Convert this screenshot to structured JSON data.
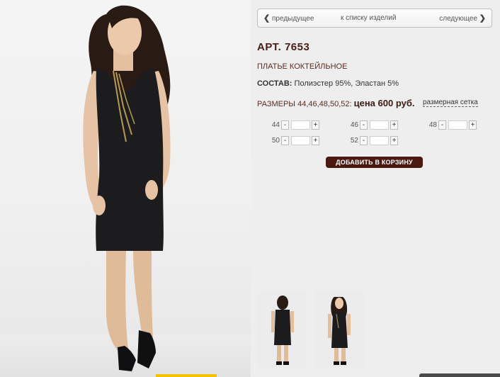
{
  "nav": {
    "prev": "предыдущее",
    "list": "к списку изделий",
    "next": "следующее"
  },
  "product": {
    "article": "АРТ. 7653",
    "title": "ПЛАТЬЕ КОКТЕЙЛЬНОЕ",
    "composition_label": "СОСТАВ:",
    "composition": "Полиэстер 95%, Эластан 5%",
    "sizes_label": "РАЗМЕРЫ 44,46,48,50,52:",
    "price": "цена 600 руб.",
    "size_chart": "размерная сетка"
  },
  "sizes": [
    {
      "label": "44",
      "minus": "-",
      "plus": "+",
      "qty": ""
    },
    {
      "label": "46",
      "minus": "-",
      "plus": "+",
      "qty": ""
    },
    {
      "label": "48",
      "minus": "-",
      "plus": "+",
      "qty": ""
    },
    {
      "label": "50",
      "minus": "-",
      "plus": "+",
      "qty": ""
    },
    {
      "label": "52",
      "minus": "-",
      "plus": "+",
      "qty": ""
    }
  ],
  "add_to_cart": "ДОБАВИТЬ В КОРЗИНУ",
  "icons": {
    "prev": "chevron-left-icon",
    "next": "chevron-right-icon"
  },
  "colors": {
    "brand": "#4a1a10",
    "dress": "#1c1c1f",
    "skin": "#e8c7a8",
    "hair": "#2a1a14"
  }
}
